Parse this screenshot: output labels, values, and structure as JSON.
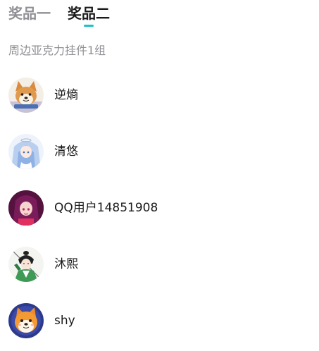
{
  "tabs": [
    {
      "label": "奖品一",
      "active": false
    },
    {
      "label": "奖品二",
      "active": true
    }
  ],
  "accent_color": "#1ec0c9",
  "prize_description": "周边亚克力挂件1组",
  "winners": [
    {
      "name": "逆熵",
      "avatar": "shiba-dog-avatar"
    },
    {
      "name": "清悠",
      "avatar": "anime-girl-blue-hair-avatar"
    },
    {
      "name": "QQ用户14851908",
      "avatar": "anime-girl-purple-hair-avatar"
    },
    {
      "name": "沐熙",
      "avatar": "ink-style-swordsman-avatar"
    },
    {
      "name": "shy",
      "avatar": "shiba-dog-cartoon-avatar"
    }
  ]
}
